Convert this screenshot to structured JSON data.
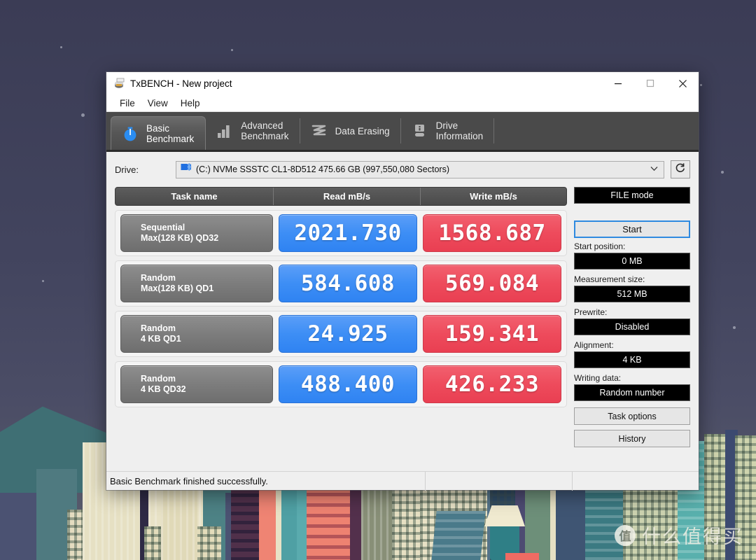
{
  "window": {
    "title": "TxBENCH - New project",
    "icon": "floppy-disk-icon",
    "controls": {
      "minimize": "—",
      "maximize": "□",
      "close": "✕"
    }
  },
  "menubar": {
    "items": [
      "File",
      "View",
      "Help"
    ]
  },
  "tabs": [
    {
      "label": "Basic\nBenchmark",
      "icon": "stopwatch-icon",
      "active": true
    },
    {
      "label": "Advanced\nBenchmark",
      "icon": "bar-chart-icon",
      "active": false
    },
    {
      "label": "Data Erasing",
      "icon": "eraser-wave-icon",
      "active": false
    },
    {
      "label": "Drive\nInformation",
      "icon": "drive-info-icon",
      "active": false
    }
  ],
  "drive": {
    "label": "Drive:",
    "selected": "(C:) NVMe SSSTC CL1-8D512  475.66 GB (997,550,080 Sectors)",
    "chevron": "⌄",
    "refresh_icon": "refresh-icon"
  },
  "table": {
    "headers": [
      "Task name",
      "Read mB/s",
      "Write mB/s"
    ],
    "rows": [
      {
        "task_line1": "Sequential",
        "task_line2": "Max(128 KB) QD32",
        "read": "2021.730",
        "write": "1568.687"
      },
      {
        "task_line1": "Random",
        "task_line2": "Max(128 KB) QD1",
        "read": "584.608",
        "write": "569.084"
      },
      {
        "task_line1": "Random",
        "task_line2": "4 KB QD1",
        "read": "24.925",
        "write": "159.341"
      },
      {
        "task_line1": "Random",
        "task_line2": "4 KB QD32",
        "read": "488.400",
        "write": "426.233"
      }
    ]
  },
  "side": {
    "mode_button": "FILE mode",
    "start_button": "Start",
    "start_position_label": "Start position:",
    "start_position_value": "0 MB",
    "measurement_size_label": "Measurement size:",
    "measurement_size_value": "512 MB",
    "prewrite_label": "Prewrite:",
    "prewrite_value": "Disabled",
    "alignment_label": "Alignment:",
    "alignment_value": "4 KB",
    "writing_data_label": "Writing data:",
    "writing_data_value": "Random number",
    "task_options_button": "Task options",
    "history_button": "History"
  },
  "statusbar": {
    "message": "Basic Benchmark finished successfully."
  },
  "watermark": {
    "logo_char": "值",
    "text": "什么值得买"
  },
  "colors": {
    "read_blue": "#3d8ef5",
    "write_red": "#ee4b5c",
    "tabstrip_dark": "#4a4a4a",
    "accent_focus": "#2f8ae0",
    "window_bg": "#efefef"
  }
}
